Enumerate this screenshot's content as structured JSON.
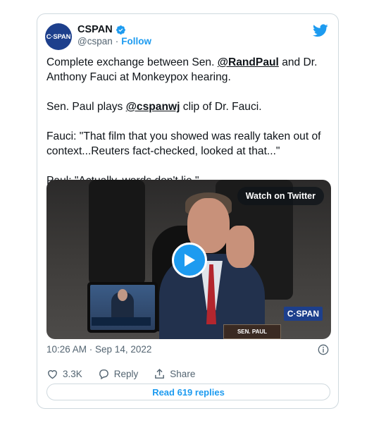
{
  "author": {
    "avatar_text": "C·SPAN",
    "name": "CSPAN",
    "handle": "@cspan",
    "separator": "·",
    "follow_label": "Follow"
  },
  "tweet": {
    "line1_pre": "Complete exchange between Sen. ",
    "mention1": "@RandPaul",
    "line1_post": " and Dr. Anthony Fauci at Monkeypox hearing.",
    "line2_pre": "Sen. Paul plays ",
    "mention2": "@cspanwj",
    "line2_post": " clip of Dr. Fauci.",
    "line3": "Fauci: \"That film that you showed was really taken out of context...Reuters fact-checked, looked at that...\"",
    "line4": "Paul: \"Actually, words don't lie.\""
  },
  "media": {
    "watch_label": "Watch on Twitter",
    "nameplate": "SEN. PAUL",
    "network_logo": "C·SPAN"
  },
  "meta": {
    "timestamp": "10:26 AM · Sep 14, 2022"
  },
  "actions": {
    "likes": "3.3K",
    "reply_label": "Reply",
    "share_label": "Share"
  },
  "read_replies_label": "Read 619 replies",
  "icons": {
    "brand": "twitter-bird-icon",
    "verified": "verified-badge-icon",
    "play": "play-icon",
    "info": "info-icon",
    "like": "heart-icon",
    "reply": "reply-bubble-icon",
    "share": "share-icon"
  },
  "colors": {
    "accent": "#1d9bf0",
    "text": "#0f1419",
    "muted": "#536471",
    "border": "#cfd9de"
  }
}
